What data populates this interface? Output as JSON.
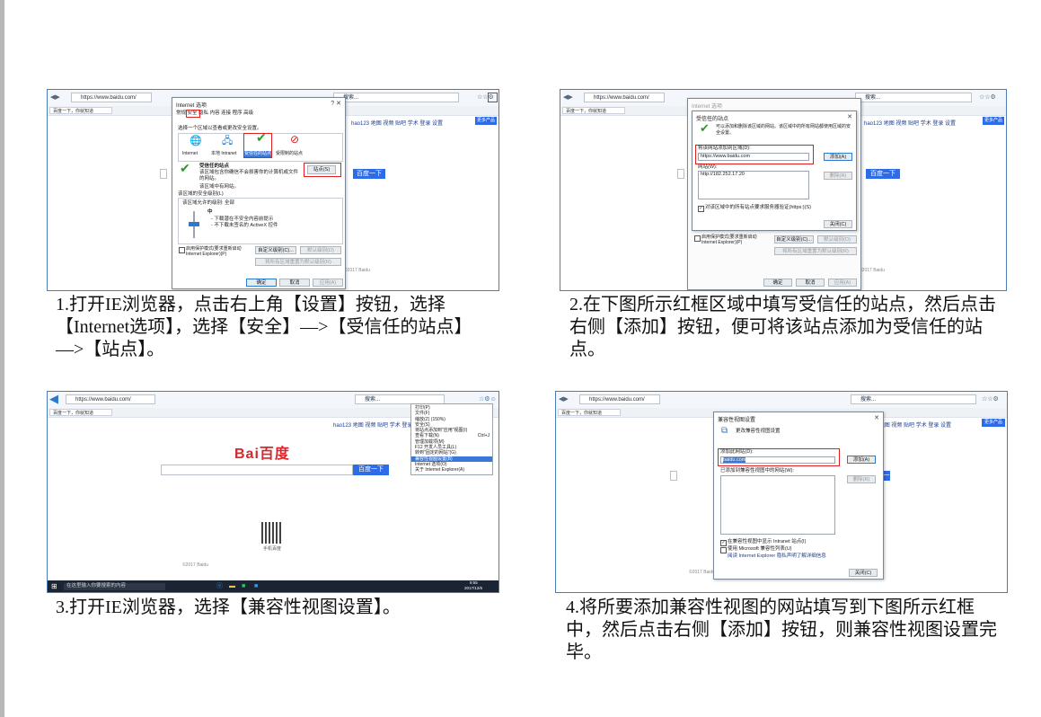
{
  "browser": {
    "url": "https://www.baidu.com/",
    "tab_label": "百度一下，你就知道",
    "search_label": "搜索...",
    "nav_links": "hao123  地图  视频  贴吧  学术  登录  设置",
    "more_products": "更多产品",
    "search_button": "百度一下",
    "footer": "©2017 Baidu"
  },
  "step1": {
    "caption": "1.打开IE浏览器，点击右上角【设置】按钮，选择【Internet选项】，选择【安全】—>【受信任的站点】—>【站点】。",
    "dialog_title": "Internet 选项",
    "tabs": "常规  安全  隐私  内容  连接  程序  高级",
    "zone_prompt": "选择一个区域以查看或更改安全设置。",
    "zones": [
      "Internet",
      "本地 Intranet",
      "受信任的站点",
      "受限制的站点"
    ],
    "zone_heading": "受信任的站点",
    "zone_desc": "该区域包含你确信不会损害你的计算机或文件的网站。",
    "zone_note": "该区域中有网站。",
    "security_level_heading": "该区域的安全级别(L)",
    "allowed_levels": "该区域允许的级别: 全部",
    "level_name": "中",
    "level_desc1": "- 下载潜在不安全内容前提示",
    "level_desc2": "- 不下载未签名的 ActiveX 控件",
    "protected_mode": "启用保护模式(要求重新启动 Internet Explorer)(P)",
    "sites_button": "站点(S)",
    "custom_level_button": "自定义级别(C)...",
    "default_level_button": "默认级别(D)",
    "reset_all_button": "将所有区域重置为默认级别(R)",
    "ok": "确定",
    "cancel": "取消",
    "apply": "应用(A)"
  },
  "step2": {
    "caption": "2.在下图所示红框区域中填写受信任的站点，然后点击右侧【添加】按钮，便可将该站点添加为受信任的站点。",
    "dialog_title": "受信任的站点",
    "info": "可以添加和删除该区域的网站。该区域中的所有网站都使用区域的安全设置。",
    "add_label": "将该网站添加到区域(D):",
    "add_value": "https://www.baidu.com",
    "add_button": "添加(A)",
    "sites_label": "网站(W):",
    "site_entry": "http://182.252.17.20",
    "remove_button": "删除(R)",
    "https_checkbox": "对该区域中的所有站点要求服务器验证(https:)(S)",
    "close_button": "关闭(C)"
  },
  "step3": {
    "caption": "3.打开IE浏览器，选择【兼容性视图设置】。",
    "logo": "Bai百度",
    "menu_items": [
      "打印(P)",
      "文件(F)",
      "缩放(Z) (150%)",
      "安全(S)",
      "将站点添加到\"应用\"视图(I)",
      "查看下载(N)",
      "管理加载项(M)",
      "F12 开发人员工具(L)",
      "转到\"固定的网站\"(G)",
      "兼容性视图设置(B)",
      "Internet 选项(O)",
      "关于 Internet Explorer(A)"
    ],
    "menu_shortcut": "Ctrl+J",
    "qr_label": "手机百度",
    "taskbar_search": "在这里输入你要搜索的内容",
    "time": "9:55",
    "date": "2017/12/6"
  },
  "step4": {
    "caption": "4.将所要添加兼容性视图的网站填写到下图所示红框中，然后点击右侧【添加】按钮，则兼容性视图设置完毕。",
    "dialog_title": "兼容性视图设置",
    "heading": "更改兼容性视图设置",
    "add_label": "添加此网站(D):",
    "add_value": "baidu.com",
    "add_button": "添加(A)",
    "list_label": "已添加到兼容性视图中的网站(W):",
    "remove_button": "删除(R)",
    "check1": "在兼容性视图中显示 Intranet 站点(I)",
    "check2": "使用 Microsoft 兼容性列表(U)",
    "privacy": "阅读 Internet Explorer 隐私声明了解详细信息",
    "close_button": "关闭(C)"
  },
  "colors": {
    "border": "#4a7db3",
    "highlight": "#e02020",
    "accent": "#2e6be6"
  }
}
